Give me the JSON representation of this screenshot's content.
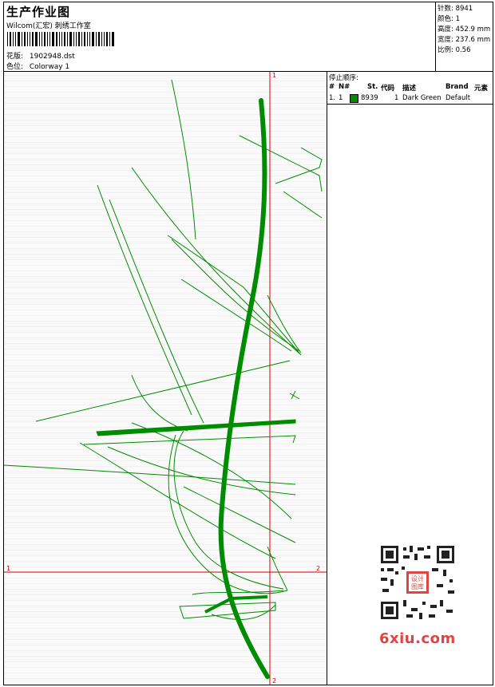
{
  "header": {
    "title": "生产作业图",
    "company": "Wilcom(汇宏) 刺绣工作室",
    "design_label": "花版:",
    "design_value": "1902948.dst",
    "color_label": "色位:",
    "color_value": "Colorway 1"
  },
  "stats": {
    "stitches": "针数: 8941",
    "colors": "颜色: 1",
    "height": "高度: 452.9 mm",
    "width": "宽度: 237.6 mm",
    "scale": "比例: 0.56"
  },
  "canvas": {
    "markers": {
      "top": "1",
      "left": "1",
      "right": "2",
      "bottom": "2"
    },
    "thread_color": "#008c00",
    "guide_color": "#e00000"
  },
  "stop_sequence": {
    "title": "停止顺序:",
    "columns": {
      "num": "#",
      "no": "N#",
      "stitches": "St.",
      "code": "代码",
      "desc": "描述",
      "brand": "Brand",
      "element": "元素"
    },
    "rows": [
      {
        "num": "1.",
        "no": "1",
        "stitches": "8939",
        "code": "1",
        "desc": "Dark Green",
        "brand": "Default",
        "color": "#008c00"
      }
    ]
  },
  "watermark": {
    "brand": "6xiu.com",
    "center_label": "设计\n图库"
  }
}
